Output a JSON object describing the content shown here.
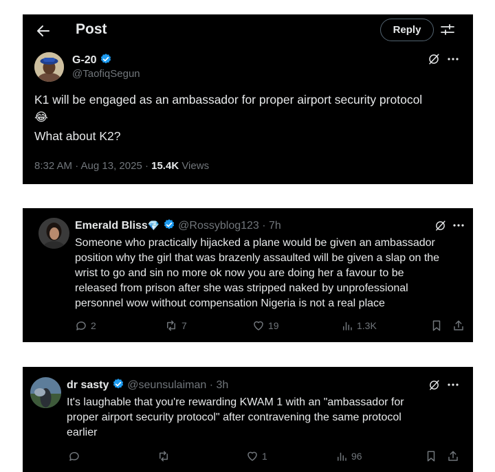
{
  "header": {
    "title": "Post",
    "reply_label": "Reply"
  },
  "post": {
    "name": "G-20",
    "handle": "@TaofiqSegun",
    "text_line1": "K1 will be engaged as an ambassador for proper airport security protocol",
    "emoji": "😂",
    "text_line3": "What about K2?",
    "timestamp": "8:32 AM · Aug 13, 2025 · ",
    "views_count": "15.4K",
    "views_label": " Views"
  },
  "replies": [
    {
      "name": "Emerald Bliss",
      "name_emoji": "💎",
      "handle_time": "@Rossyblog123 · 7h",
      "lines": [
        "Someone who practically hijacked a plane would be given an ambassador",
        "position why the girl that was brazenly assaulted will be given a slap on the",
        "wrist to go and sin no more ok now you are doing her a favour to be",
        "released from prison after she was stripped naked by unprofessional",
        "personnel wow without compensation Nigeria is not a real place"
      ],
      "replies": "2",
      "reposts": "7",
      "likes": "19",
      "views": "1.3K"
    },
    {
      "name": "dr sasty",
      "handle_time": "@seunsulaiman · 3h",
      "lines": [
        "It's laughable that you're rewarding KWAM 1 with an \"ambassador for",
        "proper airport security protocol\" after contravening the same protocol",
        "earlier"
      ],
      "replies": "",
      "reposts": "",
      "likes": "1",
      "views": "96"
    }
  ],
  "colors": {
    "background": "#000000",
    "text": "#e7e9ea",
    "muted": "#71767b",
    "verified": "#1d9bf0"
  },
  "icons": [
    "back-arrow-icon",
    "adjust-icon",
    "grok-icon",
    "more-icon",
    "verified-icon",
    "reply-icon",
    "repost-icon",
    "like-icon",
    "views-icon",
    "bookmark-icon",
    "share-icon"
  ]
}
